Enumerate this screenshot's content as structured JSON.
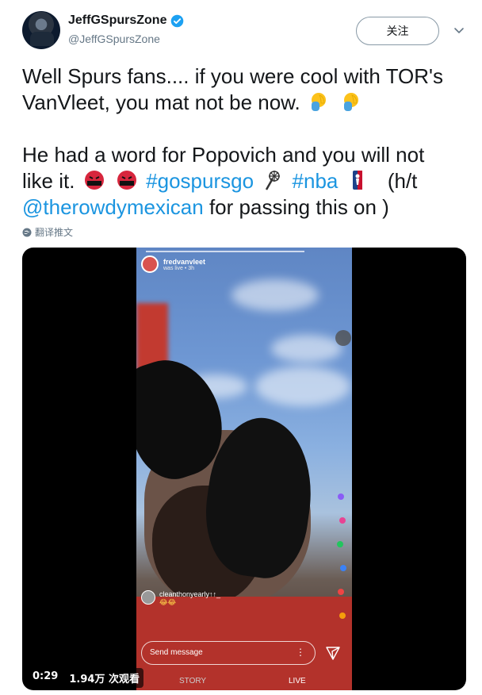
{
  "author": {
    "display_name": "JeffGSpursZone",
    "handle": "@JeffGSpursZone",
    "verified": true
  },
  "follow_button_label": "关注",
  "tweet": {
    "line1": "Well Spurs fans.... if you were cool with TOR's",
    "line2": "VanVleet, you mat not be now.",
    "line3": "He had a word for Popovich and you will not",
    "line4_start": "like it.",
    "hashtag_spurs": "#gospursgo",
    "hashtag_nba": "#nba",
    "ht": "(h/t",
    "mention": "@therowdymexican",
    "line5_rest": "for passing this on )"
  },
  "translate_label": "翻译推文",
  "video": {
    "duration": "0:29",
    "views": "1.94万 次观看",
    "story_username": "fredvanvleet",
    "story_status": "was live • 3h",
    "comment_username": "cleanthonyearly↑↑_",
    "comment_text": "😂😂",
    "send_placeholder": "Send message",
    "tab_story": "STORY",
    "tab_live": "LIVE"
  },
  "colors": {
    "link": "#1b95e0",
    "verified": "#1da1f2",
    "secondary_text": "#657786"
  }
}
